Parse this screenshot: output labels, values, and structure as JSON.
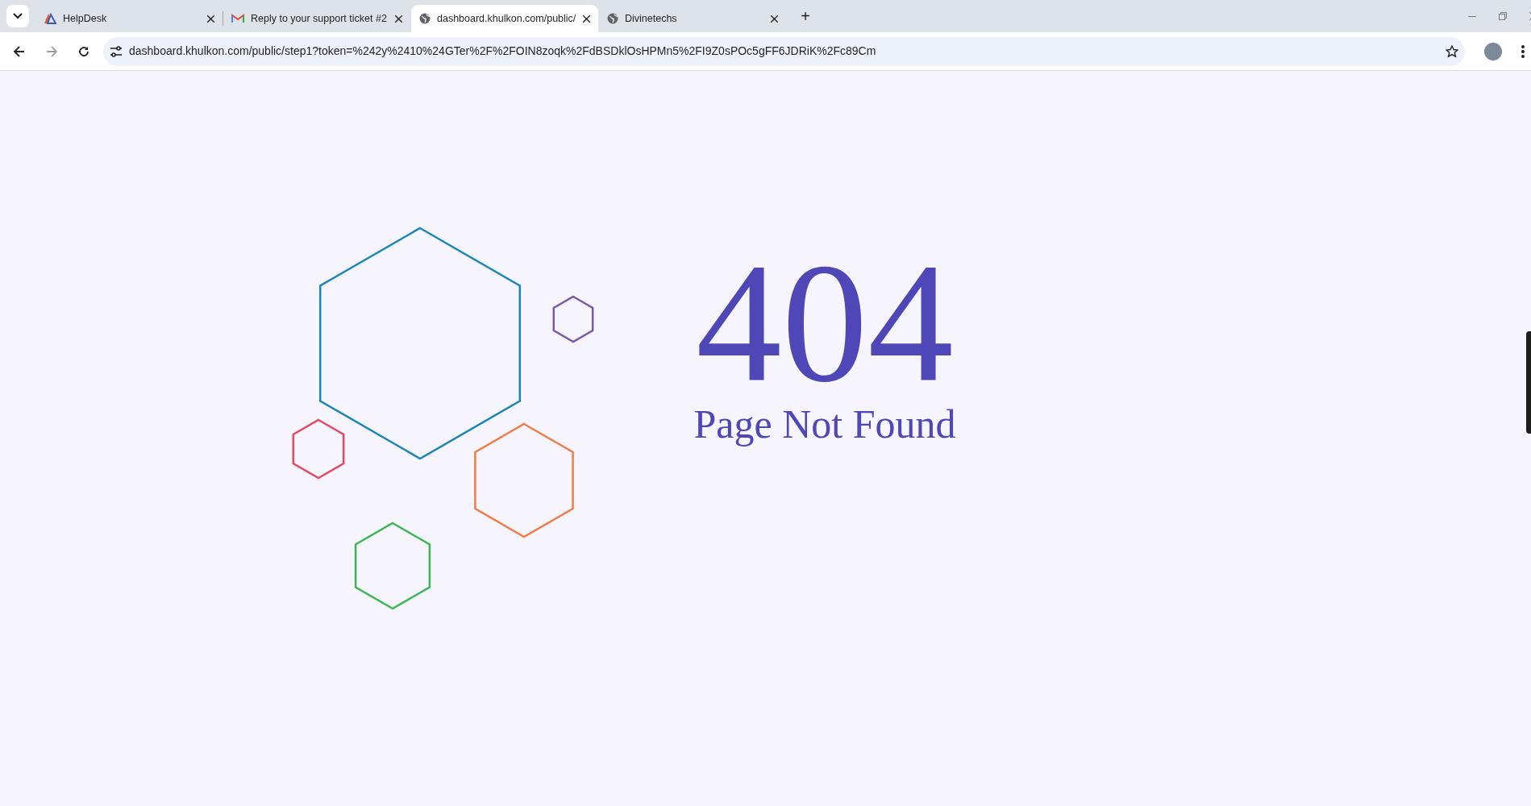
{
  "browser": {
    "tabs": [
      {
        "title": "HelpDesk",
        "kind": "logo",
        "selected": false
      },
      {
        "title": "Reply to your support ticket #2",
        "kind": "mail",
        "selected": false
      },
      {
        "title": "dashboard.khulkon.com/public/",
        "kind": "globe",
        "selected": true
      },
      {
        "title": "Divinetechs",
        "kind": "globe",
        "selected": false
      }
    ],
    "new_tab": "+",
    "address": "dashboard.khulkon.com/public/step1?token=%242y%2410%24GTer%2F%2FOIN8zoqk%2FdBSDklOsHPMn5%2FI9Z0sPOc5gFF6JDRiK%2Fc89Cm"
  },
  "page": {
    "code": "404",
    "message": "Page Not Found"
  }
}
